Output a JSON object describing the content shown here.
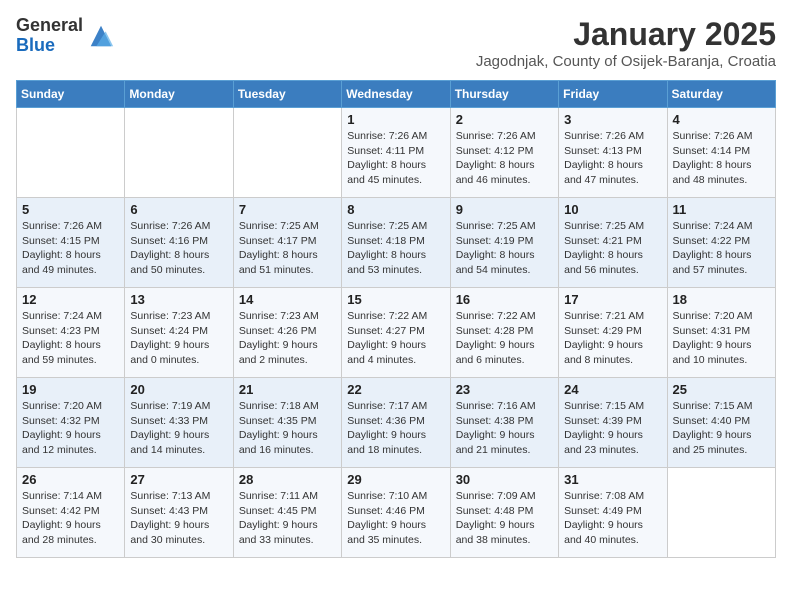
{
  "header": {
    "logo_general": "General",
    "logo_blue": "Blue",
    "month_title": "January 2025",
    "subtitle": "Jagodnjak, County of Osijek-Baranja, Croatia"
  },
  "days_of_week": [
    "Sunday",
    "Monday",
    "Tuesday",
    "Wednesday",
    "Thursday",
    "Friday",
    "Saturday"
  ],
  "weeks": [
    [
      {
        "day": "",
        "info": ""
      },
      {
        "day": "",
        "info": ""
      },
      {
        "day": "",
        "info": ""
      },
      {
        "day": "1",
        "info": "Sunrise: 7:26 AM\nSunset: 4:11 PM\nDaylight: 8 hours\nand 45 minutes."
      },
      {
        "day": "2",
        "info": "Sunrise: 7:26 AM\nSunset: 4:12 PM\nDaylight: 8 hours\nand 46 minutes."
      },
      {
        "day": "3",
        "info": "Sunrise: 7:26 AM\nSunset: 4:13 PM\nDaylight: 8 hours\nand 47 minutes."
      },
      {
        "day": "4",
        "info": "Sunrise: 7:26 AM\nSunset: 4:14 PM\nDaylight: 8 hours\nand 48 minutes."
      }
    ],
    [
      {
        "day": "5",
        "info": "Sunrise: 7:26 AM\nSunset: 4:15 PM\nDaylight: 8 hours\nand 49 minutes."
      },
      {
        "day": "6",
        "info": "Sunrise: 7:26 AM\nSunset: 4:16 PM\nDaylight: 8 hours\nand 50 minutes."
      },
      {
        "day": "7",
        "info": "Sunrise: 7:25 AM\nSunset: 4:17 PM\nDaylight: 8 hours\nand 51 minutes."
      },
      {
        "day": "8",
        "info": "Sunrise: 7:25 AM\nSunset: 4:18 PM\nDaylight: 8 hours\nand 53 minutes."
      },
      {
        "day": "9",
        "info": "Sunrise: 7:25 AM\nSunset: 4:19 PM\nDaylight: 8 hours\nand 54 minutes."
      },
      {
        "day": "10",
        "info": "Sunrise: 7:25 AM\nSunset: 4:21 PM\nDaylight: 8 hours\nand 56 minutes."
      },
      {
        "day": "11",
        "info": "Sunrise: 7:24 AM\nSunset: 4:22 PM\nDaylight: 8 hours\nand 57 minutes."
      }
    ],
    [
      {
        "day": "12",
        "info": "Sunrise: 7:24 AM\nSunset: 4:23 PM\nDaylight: 8 hours\nand 59 minutes."
      },
      {
        "day": "13",
        "info": "Sunrise: 7:23 AM\nSunset: 4:24 PM\nDaylight: 9 hours\nand 0 minutes."
      },
      {
        "day": "14",
        "info": "Sunrise: 7:23 AM\nSunset: 4:26 PM\nDaylight: 9 hours\nand 2 minutes."
      },
      {
        "day": "15",
        "info": "Sunrise: 7:22 AM\nSunset: 4:27 PM\nDaylight: 9 hours\nand 4 minutes."
      },
      {
        "day": "16",
        "info": "Sunrise: 7:22 AM\nSunset: 4:28 PM\nDaylight: 9 hours\nand 6 minutes."
      },
      {
        "day": "17",
        "info": "Sunrise: 7:21 AM\nSunset: 4:29 PM\nDaylight: 9 hours\nand 8 minutes."
      },
      {
        "day": "18",
        "info": "Sunrise: 7:20 AM\nSunset: 4:31 PM\nDaylight: 9 hours\nand 10 minutes."
      }
    ],
    [
      {
        "day": "19",
        "info": "Sunrise: 7:20 AM\nSunset: 4:32 PM\nDaylight: 9 hours\nand 12 minutes."
      },
      {
        "day": "20",
        "info": "Sunrise: 7:19 AM\nSunset: 4:33 PM\nDaylight: 9 hours\nand 14 minutes."
      },
      {
        "day": "21",
        "info": "Sunrise: 7:18 AM\nSunset: 4:35 PM\nDaylight: 9 hours\nand 16 minutes."
      },
      {
        "day": "22",
        "info": "Sunrise: 7:17 AM\nSunset: 4:36 PM\nDaylight: 9 hours\nand 18 minutes."
      },
      {
        "day": "23",
        "info": "Sunrise: 7:16 AM\nSunset: 4:38 PM\nDaylight: 9 hours\nand 21 minutes."
      },
      {
        "day": "24",
        "info": "Sunrise: 7:15 AM\nSunset: 4:39 PM\nDaylight: 9 hours\nand 23 minutes."
      },
      {
        "day": "25",
        "info": "Sunrise: 7:15 AM\nSunset: 4:40 PM\nDaylight: 9 hours\nand 25 minutes."
      }
    ],
    [
      {
        "day": "26",
        "info": "Sunrise: 7:14 AM\nSunset: 4:42 PM\nDaylight: 9 hours\nand 28 minutes."
      },
      {
        "day": "27",
        "info": "Sunrise: 7:13 AM\nSunset: 4:43 PM\nDaylight: 9 hours\nand 30 minutes."
      },
      {
        "day": "28",
        "info": "Sunrise: 7:11 AM\nSunset: 4:45 PM\nDaylight: 9 hours\nand 33 minutes."
      },
      {
        "day": "29",
        "info": "Sunrise: 7:10 AM\nSunset: 4:46 PM\nDaylight: 9 hours\nand 35 minutes."
      },
      {
        "day": "30",
        "info": "Sunrise: 7:09 AM\nSunset: 4:48 PM\nDaylight: 9 hours\nand 38 minutes."
      },
      {
        "day": "31",
        "info": "Sunrise: 7:08 AM\nSunset: 4:49 PM\nDaylight: 9 hours\nand 40 minutes."
      },
      {
        "day": "",
        "info": ""
      }
    ]
  ]
}
